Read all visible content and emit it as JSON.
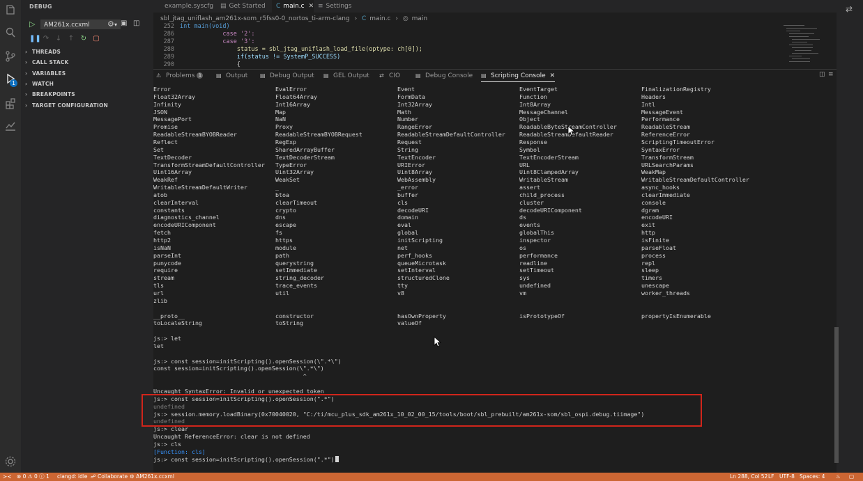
{
  "sidebar": {
    "title": "DEBUG",
    "config_select": "AM261x.ccxml",
    "sections": [
      {
        "label": "THREADS"
      },
      {
        "label": "CALL STACK"
      },
      {
        "label": "VARIABLES"
      },
      {
        "label": "WATCH"
      },
      {
        "label": "BREAKPOINTS"
      },
      {
        "label": "TARGET CONFIGURATION"
      }
    ],
    "run_badge": "1"
  },
  "editor": {
    "tabs": [
      {
        "label": "example.syscfg"
      },
      {
        "label": "Get Started"
      },
      {
        "label": "main.c"
      },
      {
        "label": "Settings"
      }
    ],
    "breadcrumb": [
      "sbl_jtag_uniflash_am261x-som_r5fss0-0_nortos_ti-arm-clang",
      "main.c",
      "main"
    ],
    "code_lines": [
      {
        "num": "252",
        "text": "int main(void)"
      },
      {
        "num": "286",
        "text": "            case '2':"
      },
      {
        "num": "287",
        "text": "            case '3':"
      },
      {
        "num": "288",
        "text": "                status = sbl_jtag_uniflash_load_file(optype: ch[0]);"
      },
      {
        "num": "289",
        "text": "                if(status != SystemP_SUCCESS)"
      },
      {
        "num": "290",
        "text": "                {"
      }
    ]
  },
  "panel": {
    "tabs": [
      {
        "label": "Problems",
        "count": "1"
      },
      {
        "label": "Output"
      },
      {
        "label": "Debug Output"
      },
      {
        "label": "GEL Output"
      },
      {
        "label": "CIO"
      },
      {
        "label": "Debug Console"
      },
      {
        "label": "Scripting Console",
        "active": true
      }
    ],
    "globals_grid": [
      [
        "Error",
        "EvalError",
        "Event",
        "EventTarget",
        "FinalizationRegistry"
      ],
      [
        "Float32Array",
        "Float64Array",
        "FormData",
        "Function",
        "Headers"
      ],
      [
        "Infinity",
        "Int16Array",
        "Int32Array",
        "Int8Array",
        "Intl"
      ],
      [
        "JSON",
        "Map",
        "Math",
        "MessageChannel",
        "MessageEvent"
      ],
      [
        "MessagePort",
        "NaN",
        "Number",
        "Object",
        "Performance"
      ],
      [
        "Promise",
        "Proxy",
        "RangeError",
        "ReadableByteStreamController",
        "ReadableStream"
      ],
      [
        "ReadableStreamBYOBReader",
        "ReadableStreamBYOBRequest",
        "ReadableStreamDefaultController",
        "ReadableStreamDefaultReader",
        "ReferenceError"
      ],
      [
        "Reflect",
        "RegExp",
        "Request",
        "Response",
        "ScriptingTimeoutError"
      ],
      [
        "Set",
        "SharedArrayBuffer",
        "String",
        "Symbol",
        "SyntaxError"
      ],
      [
        "TextDecoder",
        "TextDecoderStream",
        "TextEncoder",
        "TextEncoderStream",
        "TransformStream"
      ],
      [
        "TransformStreamDefaultController",
        "TypeError",
        "URIError",
        "URL",
        "URLSearchParams"
      ],
      [
        "Uint16Array",
        "Uint32Array",
        "Uint8Array",
        "Uint8ClampedArray",
        "WeakMap"
      ],
      [
        "WeakRef",
        "WeakSet",
        "WebAssembly",
        "WritableStream",
        "WritableStreamDefaultController"
      ],
      [
        "WritableStreamDefaultWriter",
        "_",
        "_error",
        "assert",
        "async_hooks"
      ],
      [
        "atob",
        "btoa",
        "buffer",
        "child_process",
        "clearImmediate"
      ],
      [
        "clearInterval",
        "clearTimeout",
        "cls",
        "cluster",
        "console"
      ],
      [
        "constants",
        "crypto",
        "decodeURI",
        "decodeURIComponent",
        "dgram"
      ],
      [
        "diagnostics_channel",
        "dns",
        "domain",
        "ds",
        "encodeURI"
      ],
      [
        "encodeURIComponent",
        "escape",
        "eval",
        "events",
        "exit"
      ],
      [
        "fetch",
        "fs",
        "global",
        "globalThis",
        "http"
      ],
      [
        "http2",
        "https",
        "initScripting",
        "inspector",
        "isFinite"
      ],
      [
        "isNaN",
        "module",
        "net",
        "os",
        "parseFloat"
      ],
      [
        "parseInt",
        "path",
        "perf_hooks",
        "performance",
        "process"
      ],
      [
        "punycode",
        "querystring",
        "queueMicrotask",
        "readline",
        "repl"
      ],
      [
        "require",
        "setImmediate",
        "setInterval",
        "setTimeout",
        "sleep"
      ],
      [
        "stream",
        "string_decoder",
        "structuredClone",
        "sys",
        "timers"
      ],
      [
        "tls",
        "trace_events",
        "tty",
        "undefined",
        "unescape"
      ],
      [
        "url",
        "util",
        "v8",
        "vm",
        "worker_threads"
      ],
      [
        "zlib",
        "",
        "",
        "",
        ""
      ]
    ],
    "proto_grid": [
      [
        "__proto__",
        "constructor",
        "hasOwnProperty",
        "isPrototypeOf",
        "propertyIsEnumerable"
      ],
      [
        "toLocaleString",
        "toString",
        "valueOf",
        "",
        ""
      ]
    ],
    "log": [
      {
        "text": "js:> let",
        "style": "normal"
      },
      {
        "text": "let",
        "style": "normal"
      },
      {
        "text": "",
        "style": "normal"
      },
      {
        "text": "js:> const session=initScripting().openSession(\\\".*\\\")",
        "style": "normal"
      },
      {
        "text": "const session=initScripting().openSession(\\\".*\\\")",
        "style": "normal"
      },
      {
        "text": "                                           ^",
        "style": "normal"
      },
      {
        "text": "",
        "style": "normal"
      },
      {
        "text": "Uncaught SyntaxError: Invalid or unexpected token",
        "style": "normal"
      },
      {
        "text": "js:> const session=initScripting().openSession(\".*\")",
        "style": "normal"
      },
      {
        "text": "undefined",
        "style": "gray"
      },
      {
        "text": "js:> session.memory.loadBinary(0x70040020, \"C:/ti/mcu_plus_sdk_am261x_10_02_00_15/tools/boot/sbl_prebuilt/am261x-som/sbl_ospi.debug.tiimage\")",
        "style": "normal"
      },
      {
        "text": "undefined",
        "style": "gray"
      },
      {
        "text": "js:> clear",
        "style": "normal"
      },
      {
        "text": "Uncaught ReferenceError: clear is not defined",
        "style": "normal"
      },
      {
        "text": "js:> cls",
        "style": "normal"
      },
      {
        "text": "[Function: cls]",
        "style": "blue"
      },
      {
        "text": "js:> const session=initScripting().openSession(\".*\")",
        "style": "normal"
      }
    ]
  },
  "statusbar": {
    "errors": "0",
    "warnings": "0",
    "info": "1",
    "linter": "clangd: idle",
    "collaborate": "Collaborate",
    "target": "AM261x.ccxml",
    "position": "Ln 288, Col 52",
    "eol": "LF",
    "encoding": "UTF-8",
    "indent": "Spaces: 4"
  },
  "colors": {
    "status_bar": "#cc6633",
    "highlight_box": "#d0251b",
    "accent": "#0e70c0"
  }
}
